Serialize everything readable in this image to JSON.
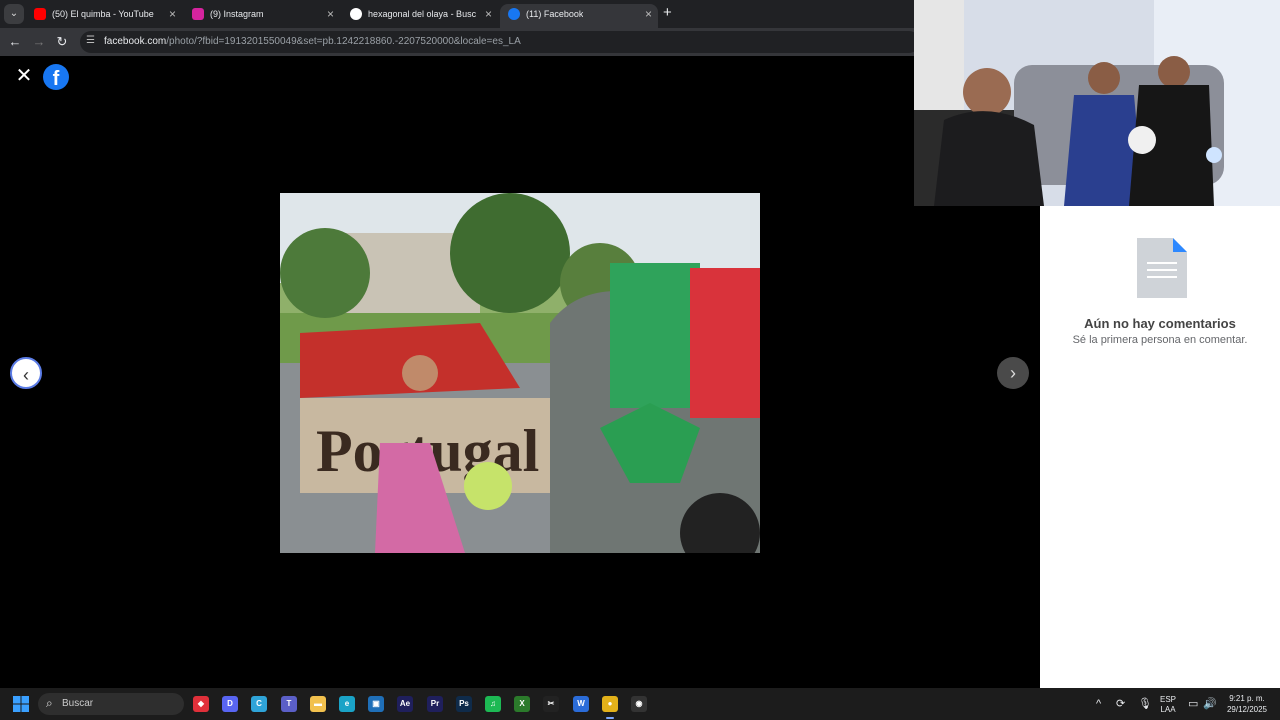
{
  "browser": {
    "tabs": [
      {
        "title": "(50) El quimba - YouTube",
        "favicon": "youtube-icon",
        "color": "#ff0000",
        "active": false
      },
      {
        "title": "(9) Instagram",
        "favicon": "instagram-icon",
        "color": "#d6249f",
        "active": false
      },
      {
        "title": "hexagonal del olaya - Buscar con Google",
        "favicon": "google-icon",
        "color": "#ffffff",
        "active": false
      },
      {
        "title": "(11) Facebook",
        "favicon": "facebook-icon",
        "color": "#1877f2",
        "active": true
      }
    ],
    "address": {
      "host": "facebook.com",
      "path": "/photo/?fbid=1913201550049&set=pb.1242218860.-2207520000&locale=es_LA"
    }
  },
  "viewer": {
    "photo_alt": "Desfile escolar con bandera de Portugal",
    "banner_text": "Portugal"
  },
  "comments": {
    "empty_title": "Aún no hay comentarios",
    "empty_subtitle": "Sé la primera persona en comentar."
  },
  "taskbar": {
    "search_placeholder": "Buscar",
    "language": "ESP",
    "keyboard": "LAA",
    "time": "9:21 p. m.",
    "date": "29/12/2025",
    "apps": [
      {
        "name": "anydesk-icon",
        "label": "◆",
        "color": "#e0303a"
      },
      {
        "name": "discord-icon",
        "label": "D",
        "color": "#5865f2"
      },
      {
        "name": "copilot-icon",
        "label": "C",
        "color": "#2fa4d8"
      },
      {
        "name": "teams-icon",
        "label": "T",
        "color": "#5b5fc7"
      },
      {
        "name": "file-explorer-icon",
        "label": "▬",
        "color": "#f2c14e"
      },
      {
        "name": "edge-icon",
        "label": "e",
        "color": "#1aa3c7"
      },
      {
        "name": "store-icon",
        "label": "▣",
        "color": "#1f6fb8"
      },
      {
        "name": "after-effects-icon",
        "label": "Ae",
        "color": "#1f1f5c"
      },
      {
        "name": "premiere-icon",
        "label": "Pr",
        "color": "#1f1f5c"
      },
      {
        "name": "photoshop-icon",
        "label": "Ps",
        "color": "#0f2b4a"
      },
      {
        "name": "spotify-icon",
        "label": "♫",
        "color": "#1db954"
      },
      {
        "name": "xbox-icon",
        "label": "X",
        "color": "#2b7a2b"
      },
      {
        "name": "capcut-icon",
        "label": "✂",
        "color": "#222222"
      },
      {
        "name": "word-icon",
        "label": "W",
        "color": "#2b6cd8"
      },
      {
        "name": "chrome-icon",
        "label": "●",
        "color": "#e3b11a"
      },
      {
        "name": "obs-icon",
        "label": "◉",
        "color": "#333333"
      }
    ]
  }
}
